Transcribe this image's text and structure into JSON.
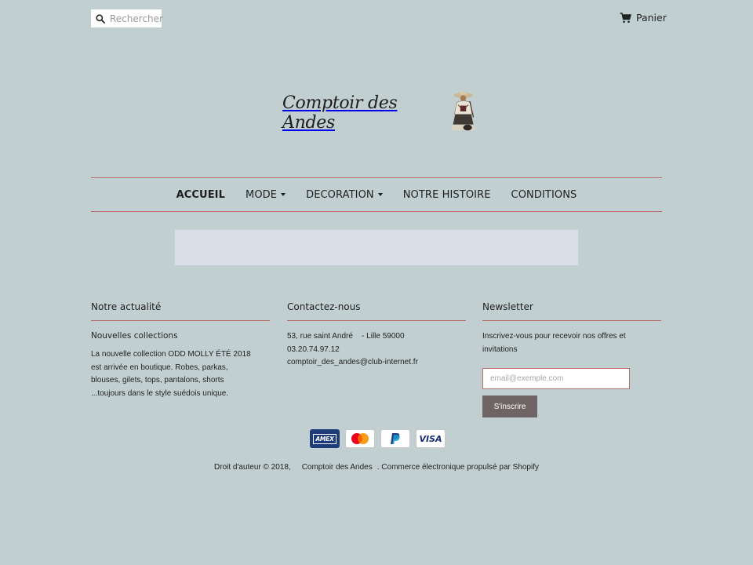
{
  "header": {
    "search_placeholder": "Rechercher",
    "cart_label": "Panier",
    "logo_text": "Comptoir des Andes"
  },
  "nav": {
    "items": [
      {
        "label": "ACCUEIL",
        "active": true,
        "dropdown": false
      },
      {
        "label": "MODE",
        "active": false,
        "dropdown": true
      },
      {
        "label": "DECORATION",
        "active": false,
        "dropdown": true
      },
      {
        "label": "NOTRE HISTOIRE",
        "active": false,
        "dropdown": false
      },
      {
        "label": "CONDITIONS",
        "active": false,
        "dropdown": false
      }
    ]
  },
  "footer": {
    "news": {
      "title": "Notre actualité",
      "article_title": "Nouvelles collections",
      "article_text": "La nouvelle collection ODD MOLLY ÉTÉ 2018 est arrivée en boutique. Robes, parkas, blouses, gilets, tops, pantalons, shorts ...toujours dans le style suédois unique."
    },
    "contact": {
      "title": "Contactez-nous",
      "address": "53, rue saint André    - Lille 59000",
      "phone": "03.20.74.97.12",
      "email": "comptoir_des_andes@club-internet.fr"
    },
    "newsletter": {
      "title": "Newsletter",
      "text": "Inscrivez-vous pour recevoir nos offres et invitations",
      "email_placeholder": "email@exemple.com",
      "button_label": "S'inscrire"
    },
    "payments": [
      "american-express-icon",
      "mastercard-icon",
      "paypal-icon",
      "visa-icon"
    ],
    "payment_labels": {
      "amex": "AMEX",
      "visa": "VISA"
    },
    "copyright_prefix": "Droit d'auteur © 2018,",
    "copyright_shop": "Comptoir des Andes",
    "copyright_suffix": ". Commerce électronique propulsé par Shopify"
  },
  "colors": {
    "background": "#c2cfd1",
    "accent_rule": "#b9706c",
    "button": "#6e6465",
    "banner": "#d8dfe8"
  }
}
